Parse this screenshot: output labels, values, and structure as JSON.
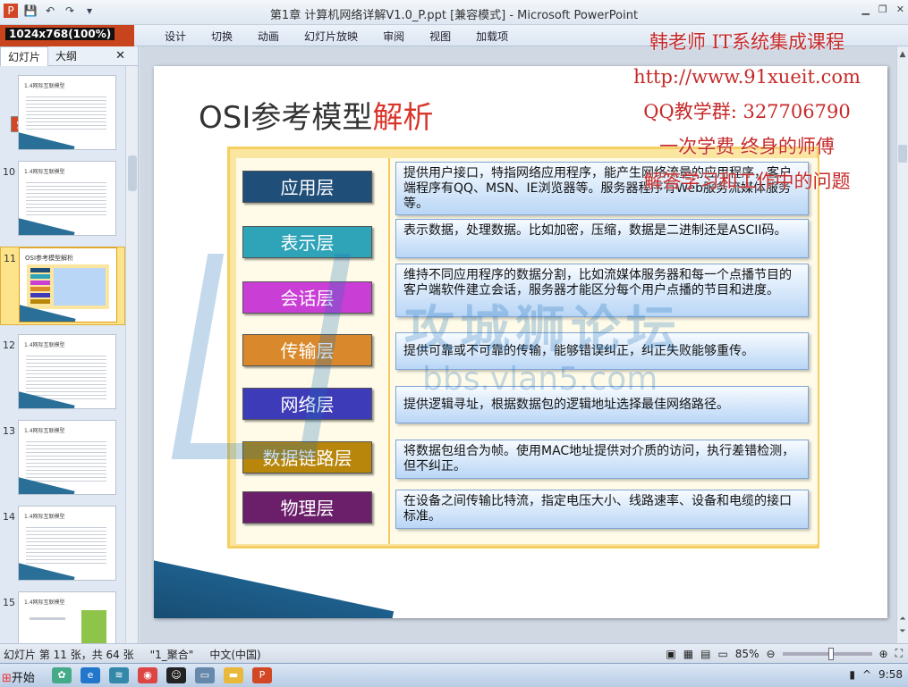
{
  "window": {
    "title": "第1章 计算机网络详解V1.0_P.ppt [兼容模式] - Microsoft PowerPoint",
    "resolution_badge": "1024x768(100%)"
  },
  "ribbon": {
    "tabs": [
      "设计",
      "切换",
      "动画",
      "幻灯片放映",
      "审阅",
      "视图",
      "加载项"
    ]
  },
  "promo": {
    "lines": [
      "韩老师 IT系统集成课程",
      "http://www.91xueit.com",
      "QQ教学群: 327706790",
      "一次学费  终身的师傅",
      "解答学习和工作中的问题"
    ]
  },
  "left_pane": {
    "tab_slides": "幻灯片",
    "tab_outline": "大纲",
    "close": "✕",
    "thumbnails": [
      {
        "num": "",
        "title": "1.4网际互联模型"
      },
      {
        "num": "10",
        "title": "1.4网际互联模型"
      },
      {
        "num": "11",
        "title": "OSI参考模型解析"
      },
      {
        "num": "12",
        "title": "1.4网际互联模型"
      },
      {
        "num": "13",
        "title": "1.4网际互联模型"
      },
      {
        "num": "14",
        "title": "1.4网际互联模型"
      },
      {
        "num": "15",
        "title": "1.4网际互联模型"
      }
    ]
  },
  "slide": {
    "title_main": "OSI参考模型",
    "title_accent": "解析",
    "layers": [
      {
        "name": "应用层",
        "color": "#1f4e79",
        "desc": "提供用户接口，特指网络应用程序，能产生网络流量的应用程序，客户端程序有QQ、MSN、IE浏览器等。服务器程序有Web服务流媒体服务等。"
      },
      {
        "name": "表示层",
        "color": "#2fa3b8",
        "desc": "表示数据，处理数据。比如加密，压缩，数据是二进制还是ASCII码。"
      },
      {
        "name": "会话层",
        "color": "#c93fd6",
        "desc": "维持不同应用程序的数据分割，比如流媒体服务器和每一个点播节目的客户端软件建立会话，服务器才能区分每个用户点播的节目和进度。"
      },
      {
        "name": "传输层",
        "color": "#d9892b",
        "desc": "提供可靠或不可靠的传输，能够错误纠正，纠正失败能够重传。"
      },
      {
        "name": "网络层",
        "color": "#3e3bb8",
        "desc": "提供逻辑寻址，根据数据包的逻辑地址选择最佳网络路径。"
      },
      {
        "name": "数据链路层",
        "color": "#b8860b",
        "desc": "将数据包组合为帧。使用MAC地址提供对介质的访问，执行差错检测，但不纠正。"
      },
      {
        "name": "物理层",
        "color": "#6b1f6b",
        "desc": "在设备之间传输比特流，指定电压大小、线路速率、设备和电缆的接口标准。"
      }
    ],
    "watermark_text": "攻城狮论坛",
    "watermark_url": "bbs.vlan5.com"
  },
  "statusbar": {
    "slide_info": "幻灯片 第 11 张，共 64 张",
    "theme": "\"1_聚合\"",
    "language": "中文(中国)",
    "zoom": "85%",
    "zoom_fraction": 0.55
  },
  "taskbar": {
    "start": "开始",
    "clock": "9:58"
  }
}
